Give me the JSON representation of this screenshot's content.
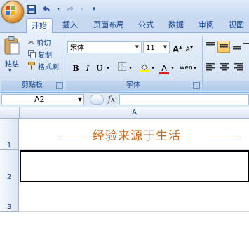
{
  "quick_access": {
    "undo_icon": "undo-icon",
    "redo_icon": "redo-icon",
    "customize_icon": "chevron-down-icon"
  },
  "tabs": [
    "开始",
    "插入",
    "页面布局",
    "公式",
    "数据",
    "审阅",
    "视图"
  ],
  "active_tab": "开始",
  "clipboard": {
    "paste_label": "粘贴",
    "cut_label": "剪切",
    "copy_label": "复制",
    "format_painter_label": "格式刷",
    "group_label": "剪贴板"
  },
  "font": {
    "font_name": "宋体",
    "font_size": "11",
    "group_label": "字体",
    "bold": "B",
    "italic": "I",
    "underline": "U",
    "phonetic": "wén"
  },
  "formula_bar": {
    "cell_ref": "A2",
    "fx_label": "fx",
    "content": ""
  },
  "sheet": {
    "column_header": "A",
    "rows": [
      {
        "number": "1",
        "a": "经验来源于生活"
      },
      {
        "number": "2",
        "a": ""
      },
      {
        "number": "3",
        "a": ""
      }
    ]
  },
  "colors": {
    "accent_text": "#c66b1d",
    "ribbon_text": "#15428b"
  }
}
